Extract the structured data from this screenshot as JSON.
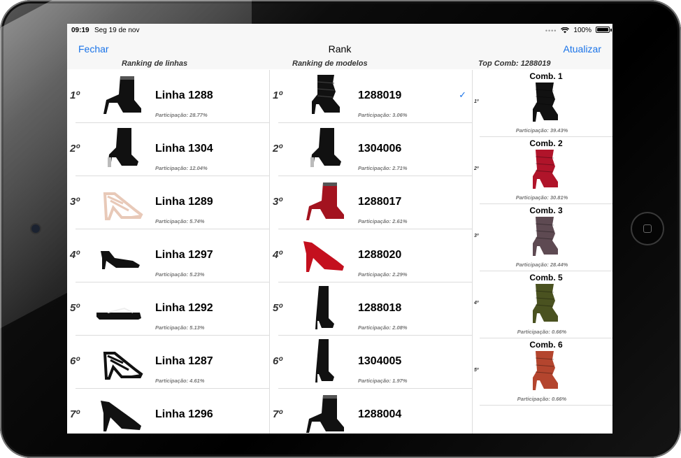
{
  "status": {
    "time": "09:19",
    "date": "Seg 19 de nov",
    "battery": "100%"
  },
  "nav": {
    "left": "Fechar",
    "title": "Rank",
    "right": "Atualizar"
  },
  "headers": {
    "lines": "Ranking de linhas",
    "models": "Ranking de modelos",
    "top": "Top Comb: 1288019"
  },
  "lines": [
    {
      "rank": "1º",
      "title": "Linha 1288",
      "sub": "Participação: 28.77%",
      "color": "#111111",
      "shape": "bootie"
    },
    {
      "rank": "2º",
      "title": "Linha 1304",
      "sub": "Participação: 12.04%",
      "color": "#111111",
      "shape": "sockboot"
    },
    {
      "rank": "3º",
      "title": "Linha 1289",
      "sub": "Participação: 5.74%",
      "color": "#e8c9b8",
      "shape": "strappy"
    },
    {
      "rank": "4º",
      "title": "Linha 1297",
      "sub": "Participação: 5.23%",
      "color": "#111111",
      "shape": "slingback"
    },
    {
      "rank": "5º",
      "title": "Linha 1292",
      "sub": "Participação: 5.13%",
      "color": "#111111",
      "shape": "flat"
    },
    {
      "rank": "6º",
      "title": "Linha 1287",
      "sub": "Participação: 4.61%",
      "color": "#111111",
      "shape": "strappy"
    },
    {
      "rank": "7º",
      "title": "Linha 1296",
      "sub": "",
      "color": "#111111",
      "shape": "pump"
    }
  ],
  "models": [
    {
      "rank": "1º",
      "title": "1288019",
      "sub": "Participação: 3.06%",
      "color": "#111111",
      "shape": "slouch",
      "checked": true
    },
    {
      "rank": "2º",
      "title": "1304006",
      "sub": "Participação: 2.71%",
      "color": "#111111",
      "shape": "sockboot"
    },
    {
      "rank": "3º",
      "title": "1288017",
      "sub": "Participação: 2.61%",
      "color": "#a3131f",
      "shape": "bootie"
    },
    {
      "rank": "4º",
      "title": "1288020",
      "sub": "Participação: 2.29%",
      "color": "#c4101e",
      "shape": "pump"
    },
    {
      "rank": "5º",
      "title": "1288018",
      "sub": "Participação: 2.08%",
      "color": "#111111",
      "shape": "tallboot"
    },
    {
      "rank": "6º",
      "title": "1304005",
      "sub": "Participação: 1.97%",
      "color": "#111111",
      "shape": "tallboot"
    },
    {
      "rank": "7º",
      "title": "1288004",
      "sub": "",
      "color": "#111111",
      "shape": "bootie"
    }
  ],
  "combs": [
    {
      "rank": "1º",
      "title": "Comb. 1",
      "sub": "Participação: 39.43%",
      "color": "#111111"
    },
    {
      "rank": "2º",
      "title": "Comb. 2",
      "sub": "Participação: 30.81%",
      "color": "#b0142a"
    },
    {
      "rank": "3º",
      "title": "Comb. 3",
      "sub": "Participação: 28.44%",
      "color": "#5e4a52"
    },
    {
      "rank": "4º",
      "title": "Comb. 5",
      "sub": "Participação: 0.66%",
      "color": "#4a5220"
    },
    {
      "rank": "5º",
      "title": "Comb. 6",
      "sub": "Participação: 0.66%",
      "color": "#b4452e"
    }
  ]
}
